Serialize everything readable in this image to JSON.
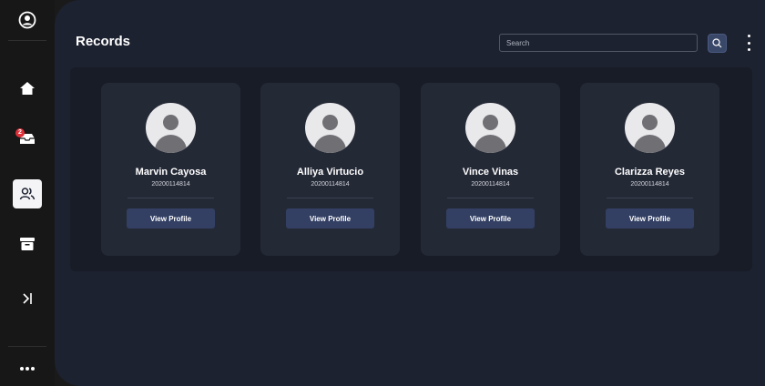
{
  "header": {
    "title": "Records"
  },
  "search": {
    "placeholder": "Search"
  },
  "sidebar": {
    "notification_count": "2",
    "items": [
      {
        "icon": "user-circle-icon"
      },
      {
        "icon": "home-icon"
      },
      {
        "icon": "inbox-icon"
      },
      {
        "icon": "users-icon",
        "active": true
      },
      {
        "icon": "archive-icon"
      },
      {
        "icon": "collapse-icon"
      },
      {
        "icon": "more-icon"
      }
    ]
  },
  "records": [
    {
      "name": "Marvin Cayosa",
      "id": "20200114814",
      "button": "View Profile"
    },
    {
      "name": "Alliya Virtucio",
      "id": "20200114814",
      "button": "View Profile"
    },
    {
      "name": "Vince Vinas",
      "id": "20200114814",
      "button": "View Profile"
    },
    {
      "name": "Clarizza Reyes",
      "id": "20200114814",
      "button": "View Profile"
    }
  ],
  "colors": {
    "background": "#1d2230",
    "card": "#242936",
    "button": "#334064",
    "badge": "#e0303a"
  }
}
